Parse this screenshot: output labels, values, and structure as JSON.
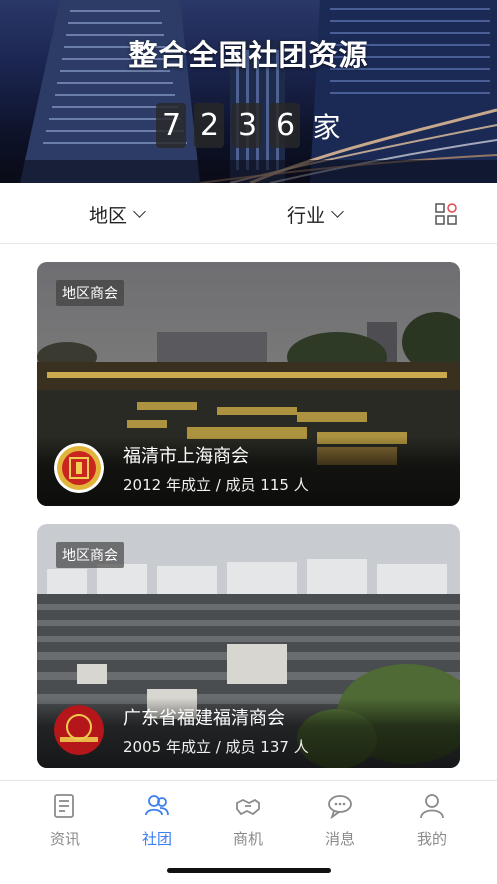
{
  "hero": {
    "title": "整合全国社团资源",
    "digits": [
      "7",
      "2",
      "3",
      "6"
    ],
    "unit": "家"
  },
  "filters": {
    "region": "地区",
    "industry": "行业"
  },
  "cards": [
    {
      "tag": "地区商会",
      "name": "福清市上海商会",
      "meta": "2012 年成立 / 成员 115 人"
    },
    {
      "tag": "地区商会",
      "name": "广东省福建福清商会",
      "meta": "2005 年成立 / 成员 137 人"
    }
  ],
  "tabs": [
    {
      "label": "资讯",
      "icon": "news-icon"
    },
    {
      "label": "社团",
      "icon": "group-icon"
    },
    {
      "label": "商机",
      "icon": "handshake-icon"
    },
    {
      "label": "消息",
      "icon": "message-icon"
    },
    {
      "label": "我的",
      "icon": "profile-icon"
    }
  ],
  "colors": {
    "accent": "#3c7ff0",
    "tab_inactive": "#8a8a8a"
  }
}
